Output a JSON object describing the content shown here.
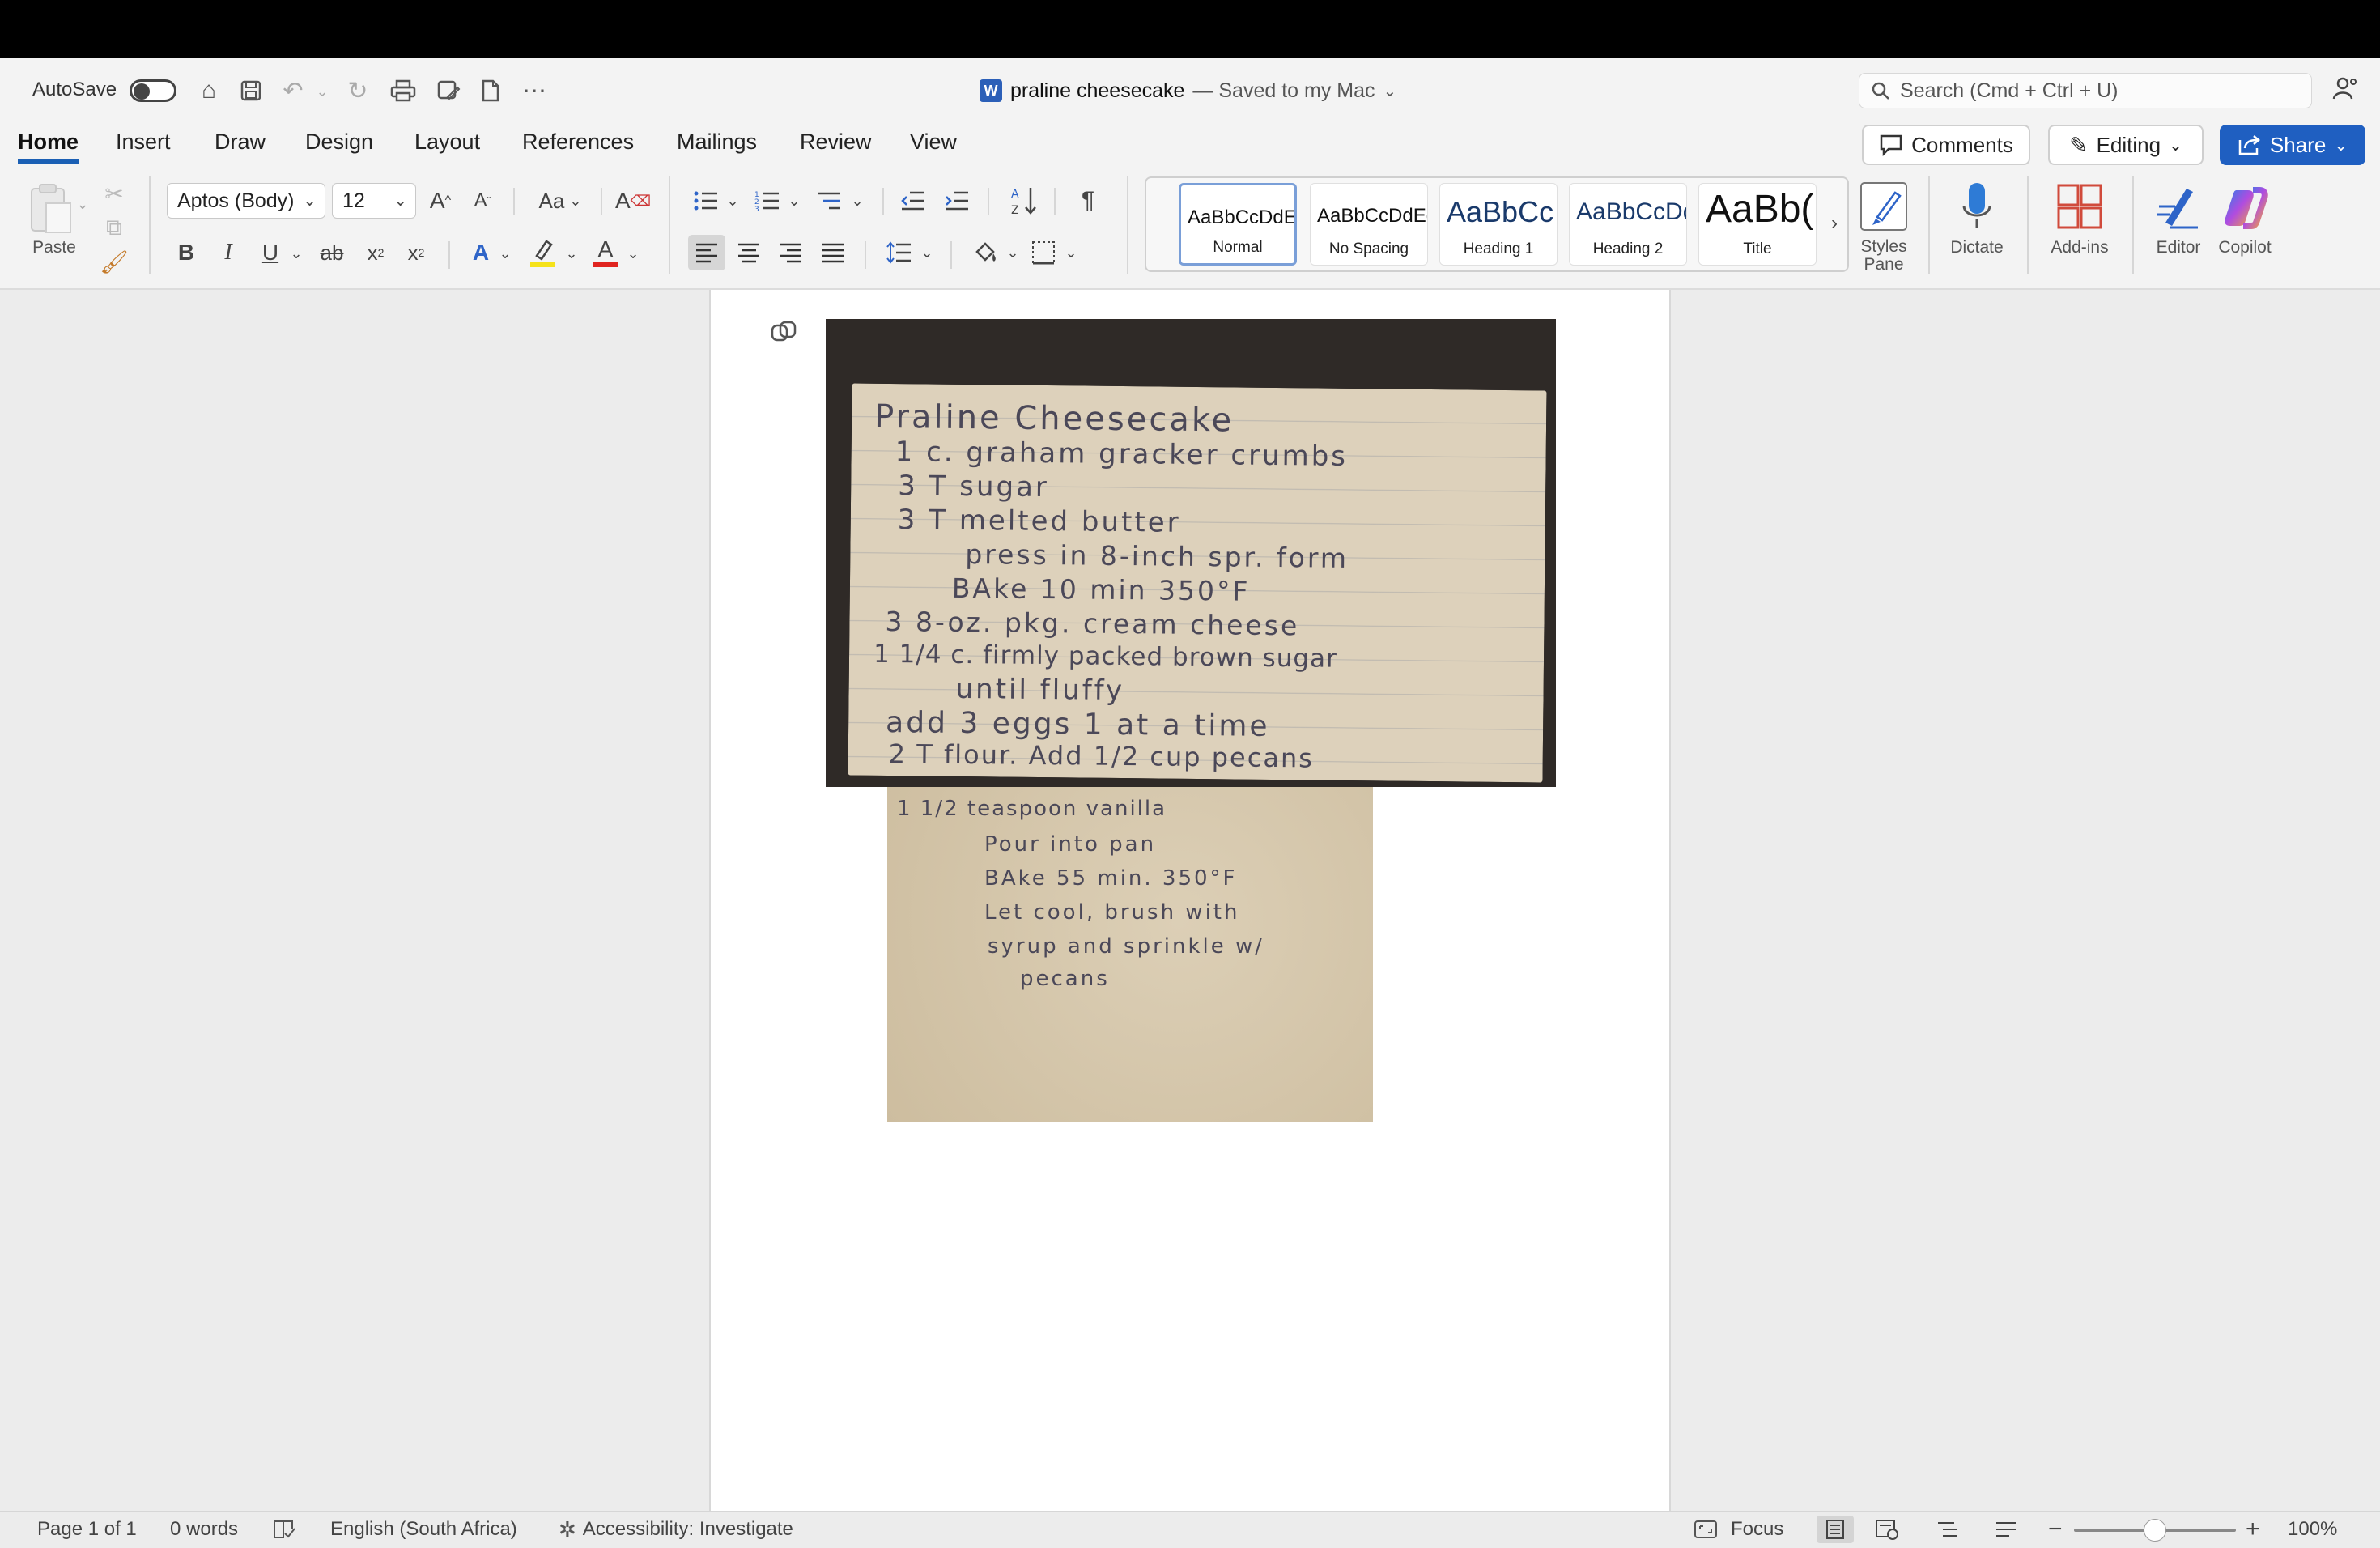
{
  "titlebar": {
    "autosave_label": "AutoSave",
    "doc_name": "praline cheesecake",
    "saved_status": "— Saved to my Mac",
    "search_placeholder": "Search (Cmd + Ctrl + U)"
  },
  "tabs": [
    "Home",
    "Insert",
    "Draw",
    "Design",
    "Layout",
    "References",
    "Mailings",
    "Review",
    "View"
  ],
  "active_tab": "Home",
  "right_buttons": {
    "comments": "Comments",
    "editing": "Editing",
    "share": "Share"
  },
  "ribbon": {
    "paste_label": "Paste",
    "font_name": "Aptos (Body)",
    "font_size": "12",
    "change_case": "Aa",
    "styles": [
      {
        "sample": "AaBbCcDdEe",
        "label": "Normal"
      },
      {
        "sample": "AaBbCcDdEe",
        "label": "No Spacing"
      },
      {
        "sample": "AaBbCc",
        "label": "Heading 1"
      },
      {
        "sample": "AaBbCcDd",
        "label": "Heading 2"
      },
      {
        "sample": "AaBb(",
        "label": "Title"
      }
    ],
    "styles_pane_label": "Styles Pane",
    "dictate_label": "Dictate",
    "addins_label": "Add-ins",
    "editor_label": "Editor",
    "copilot_label": "Copilot"
  },
  "document": {
    "card1_lines": [
      "Praline  Cheesecake",
      "1 c.  graham  gracker  crumbs",
      "3  T    sugar",
      "3  T    melted  butter",
      "press   in   8-inch  spr. form",
      "BAke   10  min   350°F",
      "3   8-oz. pkg. cream  cheese",
      "1 1/4  c.   firmly  packed  brown  sugar",
      "until  fluffy",
      "add  3  eggs   1 at a time",
      "2   T    flour.   Add 1/2  cup  pecans"
    ],
    "card2_lines": [
      "1 1/2  teaspoon  vanilla",
      "Pour  into  pan",
      "BAke  55 min.  350°F",
      "Let  cool,  brush  with",
      "syrup  and  sprinkle  w/",
      "pecans"
    ]
  },
  "statusbar": {
    "page": "Page 1 of 1",
    "words": "0 words",
    "language": "English (South Africa)",
    "accessibility": "Accessibility: Investigate",
    "focus": "Focus",
    "zoom": "100%",
    "zoom_value_percent": 100
  }
}
